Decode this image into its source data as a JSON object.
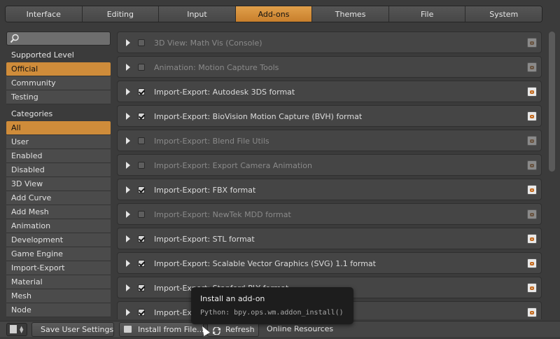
{
  "tabs": [
    "Interface",
    "Editing",
    "Input",
    "Add-ons",
    "Themes",
    "File",
    "System"
  ],
  "active_tab": "Add-ons",
  "sidebar": {
    "search": {
      "value": "",
      "placeholder": ""
    },
    "supported_title": "Supported Level",
    "supported": [
      {
        "label": "Official",
        "selected": true
      },
      {
        "label": "Community",
        "selected": false
      },
      {
        "label": "Testing",
        "selected": false
      }
    ],
    "categories_title": "Categories",
    "categories": [
      {
        "label": "All",
        "selected": true
      },
      {
        "label": "User",
        "selected": false
      },
      {
        "label": "Enabled",
        "selected": false
      },
      {
        "label": "Disabled",
        "selected": false
      },
      {
        "label": "3D View",
        "selected": false
      },
      {
        "label": "Add Curve",
        "selected": false
      },
      {
        "label": "Add Mesh",
        "selected": false
      },
      {
        "label": "Animation",
        "selected": false
      },
      {
        "label": "Development",
        "selected": false
      },
      {
        "label": "Game Engine",
        "selected": false
      },
      {
        "label": "Import-Export",
        "selected": false
      },
      {
        "label": "Material",
        "selected": false
      },
      {
        "label": "Mesh",
        "selected": false
      },
      {
        "label": "Node",
        "selected": false
      }
    ]
  },
  "addons": [
    {
      "name": "3D View: Math Vis (Console)",
      "enabled": false
    },
    {
      "name": "Animation: Motion Capture Tools",
      "enabled": false
    },
    {
      "name": "Import-Export: Autodesk 3DS format",
      "enabled": true
    },
    {
      "name": "Import-Export: BioVision Motion Capture (BVH) format",
      "enabled": true
    },
    {
      "name": "Import-Export: Blend File Utils",
      "enabled": false
    },
    {
      "name": "Import-Export: Export Camera Animation",
      "enabled": false
    },
    {
      "name": "Import-Export: FBX format",
      "enabled": true
    },
    {
      "name": "Import-Export: NewTek MDD format",
      "enabled": false
    },
    {
      "name": "Import-Export: STL format",
      "enabled": true
    },
    {
      "name": "Import-Export: Scalable Vector Graphics (SVG) 1.1 format",
      "enabled": true
    },
    {
      "name": "Import-Export: Stanford PLY format",
      "enabled": true
    },
    {
      "name": "Import-Export: Wavefront OBJ format",
      "enabled": true
    }
  ],
  "bottom": {
    "save": "Save User Settings",
    "install": "Install from File...",
    "refresh": "Refresh",
    "online": "Online Resources"
  },
  "tooltip": {
    "title": "Install an add-on",
    "python": "Python: bpy.ops.wm.addon_install()"
  },
  "colors": {
    "accent": "#cf8c3a",
    "background": "#3b3b3b",
    "tooltip": "#1d1d1d"
  }
}
